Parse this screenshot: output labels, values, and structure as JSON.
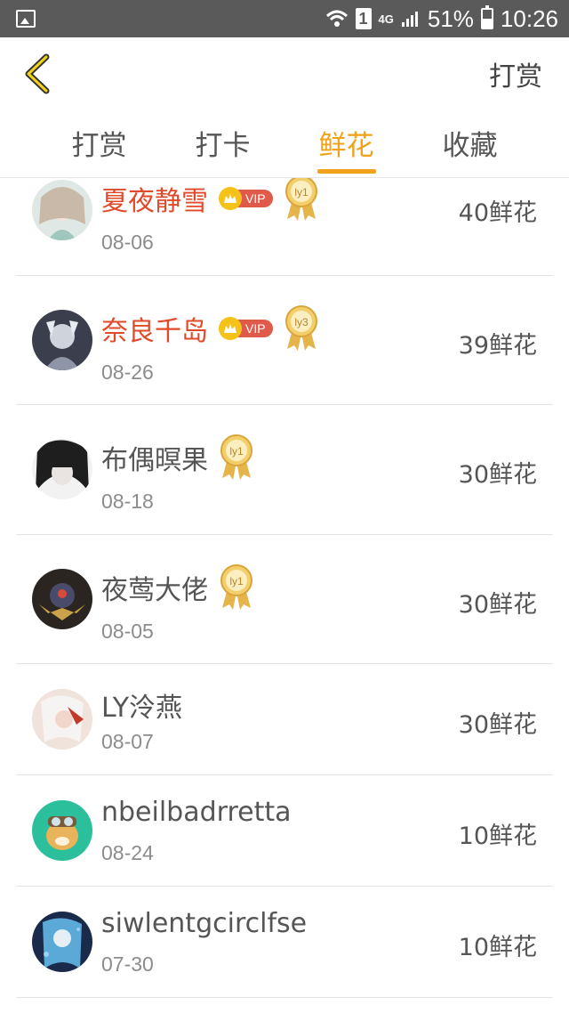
{
  "status_bar": {
    "network": "4G",
    "sim": "1",
    "battery": "51%",
    "time": "10:26"
  },
  "header": {
    "back_icon": "chevron-left-icon",
    "action_label": "打赏"
  },
  "tabs": [
    {
      "label": "打赏",
      "active": false
    },
    {
      "label": "打卡",
      "active": false
    },
    {
      "label": "鲜花",
      "active": true
    },
    {
      "label": "收藏",
      "active": false
    }
  ],
  "colors": {
    "accent": "#f0a21a",
    "vip_name": "#e04a2a",
    "vip_badge": "#e05a4a"
  },
  "entries": [
    {
      "name": "夏夜静雪",
      "vip": true,
      "vip_label": "VIP",
      "level": "ly1",
      "date": "08-06",
      "amount": "40鲜花"
    },
    {
      "name": "奈良千岛",
      "vip": true,
      "vip_label": "VIP",
      "level": "ly3",
      "date": "08-26",
      "amount": "39鲜花"
    },
    {
      "name": "布偶暝果",
      "vip": false,
      "level": "ly1",
      "date": "08-18",
      "amount": "30鲜花"
    },
    {
      "name": "夜莺大佬",
      "vip": false,
      "level": "ly1",
      "date": "08-05",
      "amount": "30鲜花"
    },
    {
      "name": "LY泠燕",
      "vip": false,
      "level": "",
      "date": "08-07",
      "amount": "30鲜花"
    },
    {
      "name": "nbeilbadrretta",
      "vip": false,
      "level": "",
      "date": "08-24",
      "amount": "10鲜花"
    },
    {
      "name": "siwlentgcirclfse",
      "vip": false,
      "level": "",
      "date": "07-30",
      "amount": "10鲜花"
    }
  ]
}
